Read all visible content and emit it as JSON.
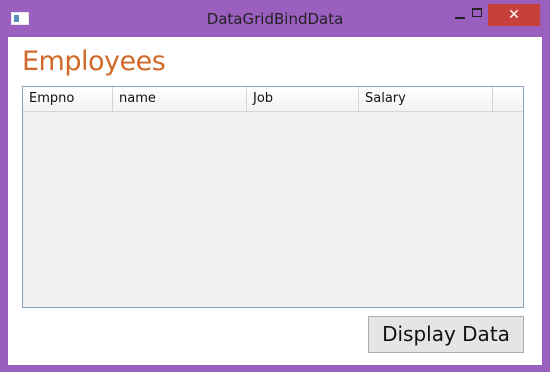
{
  "window": {
    "title": "DataGridBindData",
    "close_glyph": "✕",
    "frame_color": "#9b5fbf",
    "close_color": "#c7403b"
  },
  "main": {
    "heading": "Employees",
    "heading_color": "#cf6a2a",
    "grid": {
      "columns": [
        "Empno",
        "name",
        "Job",
        "Salary"
      ],
      "rows": []
    },
    "display_button_label": "Display Data"
  },
  "icons": {
    "app": "app-window-icon",
    "minimize": "minimize-icon",
    "maximize": "maximize-icon",
    "close": "close-icon"
  }
}
